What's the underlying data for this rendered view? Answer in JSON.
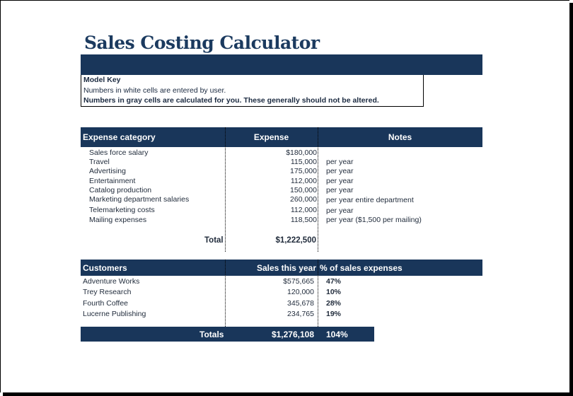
{
  "title": "Sales Costing Calculator",
  "model_key": {
    "title": "Model Key",
    "line1": "Numbers in white cells are entered by user.",
    "line2": "Numbers in gray cells are calculated for you. These generally should not be altered."
  },
  "expenses": {
    "headers": {
      "category": "Expense category",
      "expense": "Expense",
      "notes": "Notes"
    },
    "rows": [
      {
        "category": "Sales force salary",
        "expense": "$180,000",
        "notes": ""
      },
      {
        "category": "Travel",
        "expense": "115,000",
        "notes": "per year"
      },
      {
        "category": "Advertising",
        "expense": "175,000",
        "notes": "per year"
      },
      {
        "category": "Entertainment",
        "expense": "112,000",
        "notes": "per year"
      },
      {
        "category": "Catalog production",
        "expense": "150,000",
        "notes": "per year"
      },
      {
        "category": "Marketing department salaries",
        "expense": "260,000",
        "notes": "per year entire department"
      },
      {
        "category": "Telemarketing costs",
        "expense": "112,000",
        "notes": "per year"
      },
      {
        "category": "Mailing expenses",
        "expense": "118,500",
        "notes": "per year ($1,500 per mailing)"
      }
    ],
    "total_label": "Total",
    "total_value": "$1,222,500"
  },
  "customers": {
    "headers": {
      "customer": "Customers",
      "sales": "Sales this year",
      "pct": "% of sales expenses"
    },
    "rows": [
      {
        "customer": "Adventure Works",
        "sales": "$575,665",
        "pct": "47%"
      },
      {
        "customer": "Trey Research",
        "sales": "120,000",
        "pct": "10%"
      },
      {
        "customer": "Fourth Coffee",
        "sales": "345,678",
        "pct": "28%"
      },
      {
        "customer": "Lucerne Publishing",
        "sales": "234,765",
        "pct": "19%"
      }
    ],
    "totals_label": "Totals",
    "totals_sales": "$1,276,108",
    "totals_pct": "104%"
  },
  "colors": {
    "header_bg": "#19365a",
    "title": "#1b3a5f"
  }
}
